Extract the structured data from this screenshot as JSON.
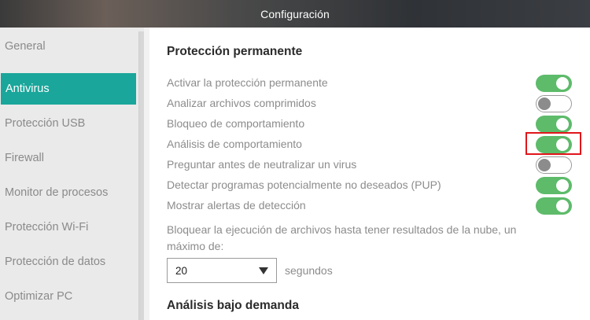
{
  "window": {
    "title": "Configuración"
  },
  "sidebar": {
    "items": [
      {
        "label": "General"
      },
      {
        "label": "Antivirus"
      },
      {
        "label": "Protección USB"
      },
      {
        "label": "Firewall"
      },
      {
        "label": "Monitor de procesos"
      },
      {
        "label": "Protección Wi-Fi"
      },
      {
        "label": "Protección de datos"
      },
      {
        "label": "Optimizar PC"
      }
    ],
    "active": "Antivirus"
  },
  "main": {
    "section_title": "Protección permanente",
    "options": [
      {
        "label": "Activar la protección permanente",
        "enabled": true
      },
      {
        "label": "Analizar archivos comprimidos",
        "enabled": false
      },
      {
        "label": "Bloqueo de comportamiento",
        "enabled": true
      },
      {
        "label": "Análisis de comportamiento",
        "enabled": true,
        "highlighted": true
      },
      {
        "label": "Preguntar antes de neutralizar un virus",
        "enabled": false
      },
      {
        "label": "Detectar programas potencialmente no deseados (PUP)",
        "enabled": true
      },
      {
        "label": "Mostrar alertas de detección",
        "enabled": true
      }
    ],
    "block_description": "Bloquear la ejecución de archivos hasta tener resultados de la nube, un máximo de:",
    "timeout_select": {
      "value": "20"
    },
    "timeout_unit": "segundos",
    "next_section_title": "Análisis bajo demanda"
  },
  "colors": {
    "accent": "#1aa69b",
    "toggle_on": "#5dbb6a",
    "highlight": "#e0161b"
  }
}
